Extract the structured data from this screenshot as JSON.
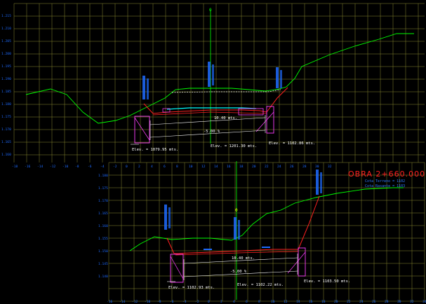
{
  "colors": {
    "grid": "#8a8a2e",
    "terrain": "#00ff00",
    "road": "#ff2020",
    "pink": "#ff40ff",
    "white": "#ffffff",
    "blue": "#1e6bff",
    "cyan": "#00ffff"
  },
  "top_section": {
    "axis_values": [
      "-18",
      "-16",
      "-14",
      "-12",
      "-10",
      "-8",
      "-6",
      "-4",
      "-2",
      "0",
      "2",
      "4",
      "6",
      "8",
      "10",
      "12",
      "14",
      "16",
      "18",
      "20",
      "22",
      "24",
      "26",
      "28",
      "30",
      "32"
    ],
    "elev_values": [
      "1.215",
      "1.210",
      "1.205",
      "1.200",
      "1.195",
      "1.190",
      "1.185",
      "1.180",
      "1.175",
      "1.170",
      "1.165",
      "1.160"
    ],
    "centerline_label": "0",
    "width_label": "10.40 mts.",
    "slope_label": "-5.00 %",
    "elev_left": "Elev. = 1079.95 mts.",
    "elev_center": "Elev. = 1201.30 mts.",
    "elev_right": "Elev. = 1102.86 mts."
  },
  "bottom_section": {
    "axis_values": [
      "-16",
      "-14",
      "-12",
      "-10",
      "-8",
      "-6",
      "-4",
      "-2",
      "0",
      "2",
      "4",
      "6",
      "8",
      "10",
      "12",
      "14",
      "16",
      "18",
      "20",
      "22",
      "24",
      "26",
      "28",
      "30",
      "32",
      "34"
    ],
    "elev_values": [
      "1.180",
      "1.175",
      "1.170",
      "1.165",
      "1.160",
      "1.155",
      "1.150",
      "1.145",
      "1.140"
    ],
    "centerline_label": "0",
    "width_label": "10.40 mts.",
    "slope_label": "-5.00 %",
    "elev_left": "Elev. = 1102.93 mts.",
    "elev_center": "Elev. = 1102.22 mts.",
    "elev_right": "Elev. = 1103.50 mts.",
    "station_label": "OBRA 2+660.000",
    "station_sub1": "Cota Terreno = 1102",
    "station_sub2": "Cota Rasante = 1103"
  }
}
